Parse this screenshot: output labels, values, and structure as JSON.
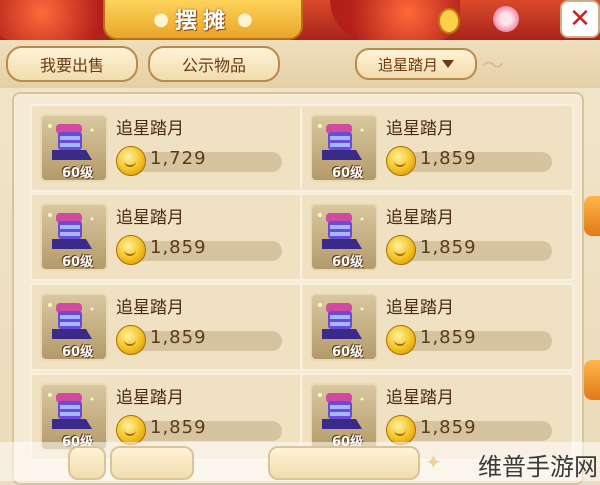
{
  "header": {
    "title": "摆摊",
    "close_icon": "close-icon",
    "close_label": "✕"
  },
  "tabs": [
    {
      "label": "我要出售"
    },
    {
      "label": "公示物品"
    }
  ],
  "filter": {
    "selected": "追星踏月",
    "icon": "triangle-down-icon"
  },
  "items": [
    {
      "name": "追星踏月",
      "level": "60级",
      "price": "1,729",
      "icon": "boots-icon"
    },
    {
      "name": "追星踏月",
      "level": "60级",
      "price": "1,859",
      "icon": "boots-icon"
    },
    {
      "name": "追星踏月",
      "level": "60级",
      "price": "1,859",
      "icon": "boots-icon"
    },
    {
      "name": "追星踏月",
      "level": "60级",
      "price": "1,859",
      "icon": "boots-icon"
    },
    {
      "name": "追星踏月",
      "level": "60级",
      "price": "1,859",
      "icon": "boots-icon"
    },
    {
      "name": "追星踏月",
      "level": "60级",
      "price": "1,859",
      "icon": "boots-icon"
    },
    {
      "name": "追星踏月",
      "level": "60级",
      "price": "1,859",
      "icon": "boots-icon"
    },
    {
      "name": "追星踏月",
      "level": "60级",
      "price": "1,859",
      "icon": "boots-icon"
    }
  ],
  "watermark": {
    "text": "维普手游网"
  },
  "colors": {
    "banner_red": "#b3201a",
    "gold": "#f2c01e",
    "panel_bg": "#f6ecd6",
    "text_brown": "#4a2a10"
  }
}
